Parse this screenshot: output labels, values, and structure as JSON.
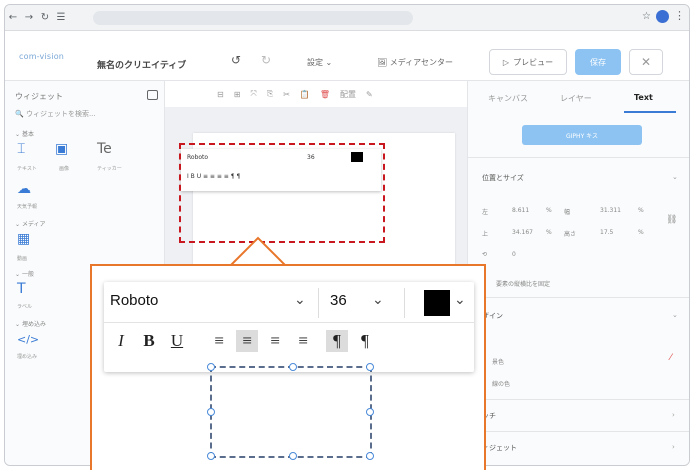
{
  "app": {
    "logo": "com-vision",
    "title": "無名のクリエイティブ",
    "settings": "設定",
    "media_center": "メディアセンター",
    "preview": "プレビュー",
    "save": "保存"
  },
  "left": {
    "title": "ウィジェット",
    "search_placeholder": "ウィジェットを検索...",
    "sections": [
      "基本",
      "メディア",
      "一般",
      "埋め込み"
    ],
    "widgets": [
      "テキスト",
      "画像",
      "ティッカー",
      "天気予報",
      "動画",
      "ラベル",
      "埋め込み"
    ]
  },
  "canvas_toolbar": {
    "arrange": "配置"
  },
  "right": {
    "tabs": [
      "キャンバス",
      "レイヤー",
      "Text"
    ],
    "giphy": "GIPHY キス",
    "position_size": "位置とサイズ",
    "fields": {
      "left_label": "左",
      "left_value": "8.611",
      "left_unit": "%",
      "width_label": "幅",
      "width_value": "31.311",
      "width_unit": "%",
      "top_label": "上",
      "top_value": "34.167",
      "top_unit": "%",
      "height_label": "高さ",
      "height_value": "17.5",
      "height_unit": "%",
      "rotation_value": "0",
      "aspect_label": "要素の縦横比を固定"
    },
    "design": "ザイン",
    "bg_color": "景色",
    "border_color": "線の色",
    "touch": "ッチ",
    "widget": "ィジェット"
  },
  "zoom_toolbar": {
    "font": "Roboto",
    "size": "36",
    "color": "#000000",
    "format_buttons": [
      "I",
      "B",
      "U",
      "≡",
      "≡",
      "≡",
      "≡",
      "¶",
      "¶"
    ]
  }
}
